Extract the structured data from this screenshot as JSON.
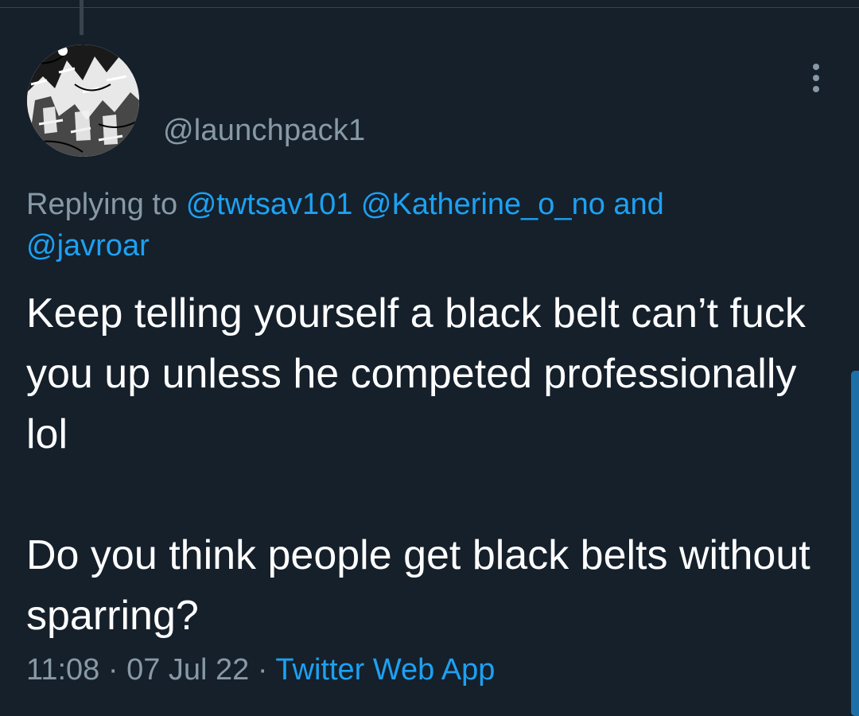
{
  "tweet": {
    "handle": "@launchpack1",
    "replying_prefix": "Replying to",
    "mentions": [
      "@twtsav101",
      "@Katherine_o_no"
    ],
    "and_word": "and",
    "last_mention": "@javroar",
    "text": "Keep telling yourself a black belt can’t fuck you up unless he competed professionally lol\n\nDo you think people get black belts without sparring?",
    "time": "11:08",
    "separator": "·",
    "date": "07 Jul 22",
    "source": "Twitter Web App"
  },
  "icons": {
    "more": "vertical-ellipsis-icon"
  },
  "colors": {
    "background": "#15202b",
    "secondary_text": "#8899a6",
    "link": "#1da1f2",
    "primary_text": "#ffffff"
  }
}
